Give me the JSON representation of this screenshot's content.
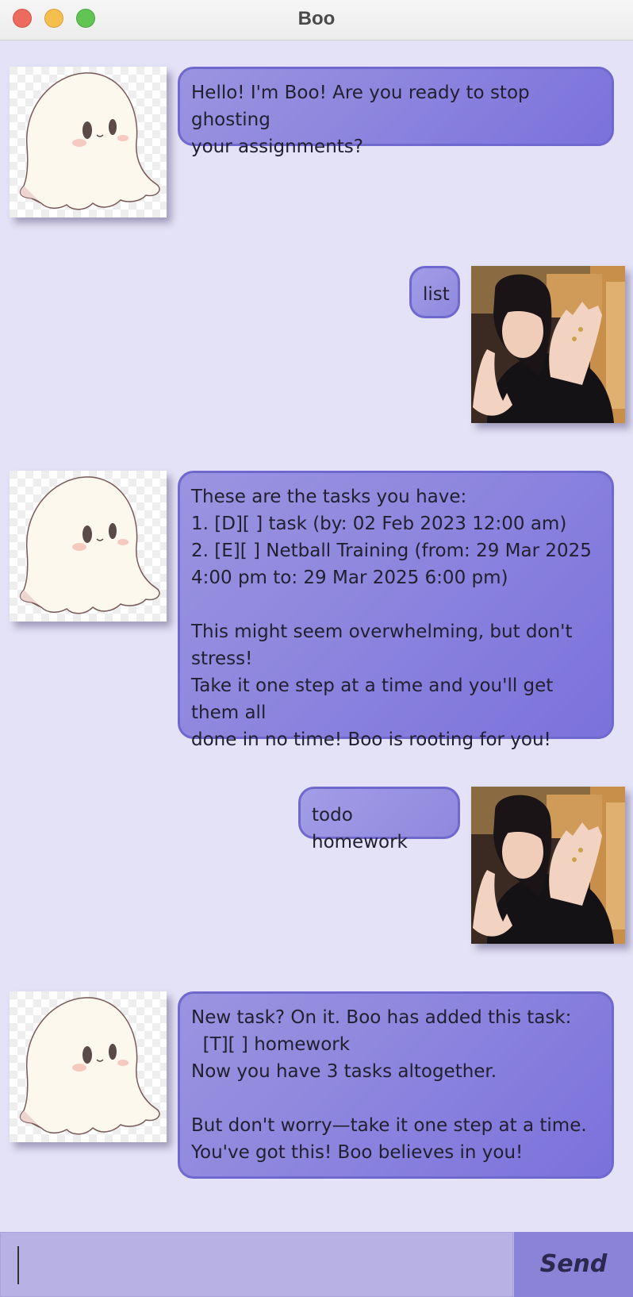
{
  "window": {
    "title": "Boo"
  },
  "messages": [
    {
      "sender": "boo",
      "text": "Hello! I'm Boo! Are you ready to stop ghosting\nyour assignments?"
    },
    {
      "sender": "user",
      "text": "list"
    },
    {
      "sender": "boo",
      "text": "These are the tasks you have:\n1. [D][ ] task (by: 02 Feb 2023 12:00 am)\n2. [E][ ] Netball Training (from: 29 Mar 2025\n4:00 pm to: 29 Mar 2025 6:00 pm)\n\nThis might seem overwhelming, but don't\nstress!\nTake it one step at a time and you'll get them all\ndone in no time! Boo is rooting for you!"
    },
    {
      "sender": "user",
      "text": "todo homework"
    },
    {
      "sender": "boo",
      "text": "New task? On it. Boo has added this task:\n  [T][ ] homework\nNow you have 3 tasks altogether.\n\nBut don't worry—take it one step at a time.\nYou've got this! Boo believes in you!"
    }
  ],
  "input": {
    "value": "",
    "placeholder": ""
  },
  "send_button": {
    "label": "Send"
  },
  "colors": {
    "background": "#e4e2f6",
    "bubble_start": "#9a94e0",
    "bubble_end": "#7b71dc",
    "bubble_border": "#6f68cf",
    "input_bar": "#b8b2e4",
    "send_button": "#8b83d7"
  },
  "icons": {
    "boo_avatar": "ghost-avatar",
    "user_avatar": "user-photo-avatar"
  }
}
